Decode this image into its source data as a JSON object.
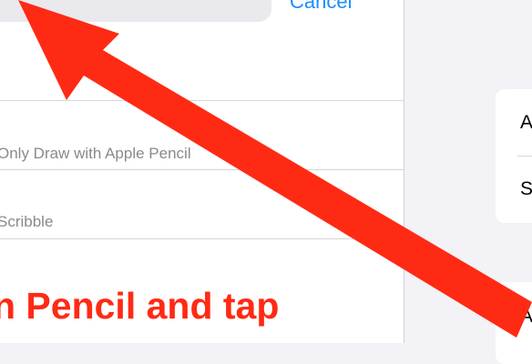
{
  "search": {
    "cancel_label": "Cancel"
  },
  "results": [
    {
      "label": "Only Draw with Apple Pencil"
    },
    {
      "label": "Scribble"
    }
  ],
  "instruction": {
    "text": "n Pencil and tap"
  },
  "settings_card": {
    "rows": [
      {
        "label": "A"
      },
      {
        "label": "S"
      }
    ]
  },
  "settings_card_2": {
    "rows": [
      {
        "label": "A"
      }
    ]
  },
  "annotation": {
    "arrow_color": "#ff2a14",
    "arrow_icon": "arrow-up-left-icon"
  }
}
